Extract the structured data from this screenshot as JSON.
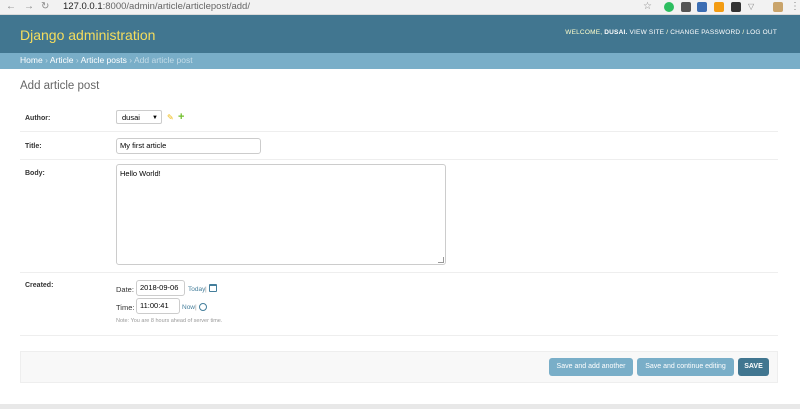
{
  "browser": {
    "url_host": "127.0.0.1",
    "url_path": ":8000/admin/article/articlepost/add/"
  },
  "header": {
    "site_name": "Django administration",
    "welcome": "WELCOME,",
    "username": "DUSAI.",
    "view_site": "VIEW SITE",
    "change_password": "CHANGE PASSWORD",
    "log_out": "LOG OUT",
    "sep": "/"
  },
  "breadcrumbs": {
    "home": "Home",
    "app": "Article",
    "model": "Article posts",
    "current": "Add article post",
    "sep": "›"
  },
  "page_title": "Add article post",
  "form": {
    "author": {
      "label": "Author:",
      "value": "dusai"
    },
    "title": {
      "label": "Title:",
      "value": "My first article"
    },
    "body": {
      "label": "Body:",
      "value": "Hello World!"
    },
    "created": {
      "label": "Created:",
      "date_label": "Date:",
      "date_value": "2018-09-06",
      "today_link": "Today",
      "time_label": "Time:",
      "time_value": "11:00:41",
      "now_link": "Now",
      "shortcut_sep": "|",
      "help": "Note: You are 8 hours ahead of server time."
    }
  },
  "buttons": {
    "save_add_another": "Save and add another",
    "save_continue": "Save and continue editing",
    "save": "SAVE"
  },
  "colors": {
    "header_bg": "#417690",
    "breadcrumb_bg": "#79aec8",
    "brand_text": "#f5dd5d"
  }
}
